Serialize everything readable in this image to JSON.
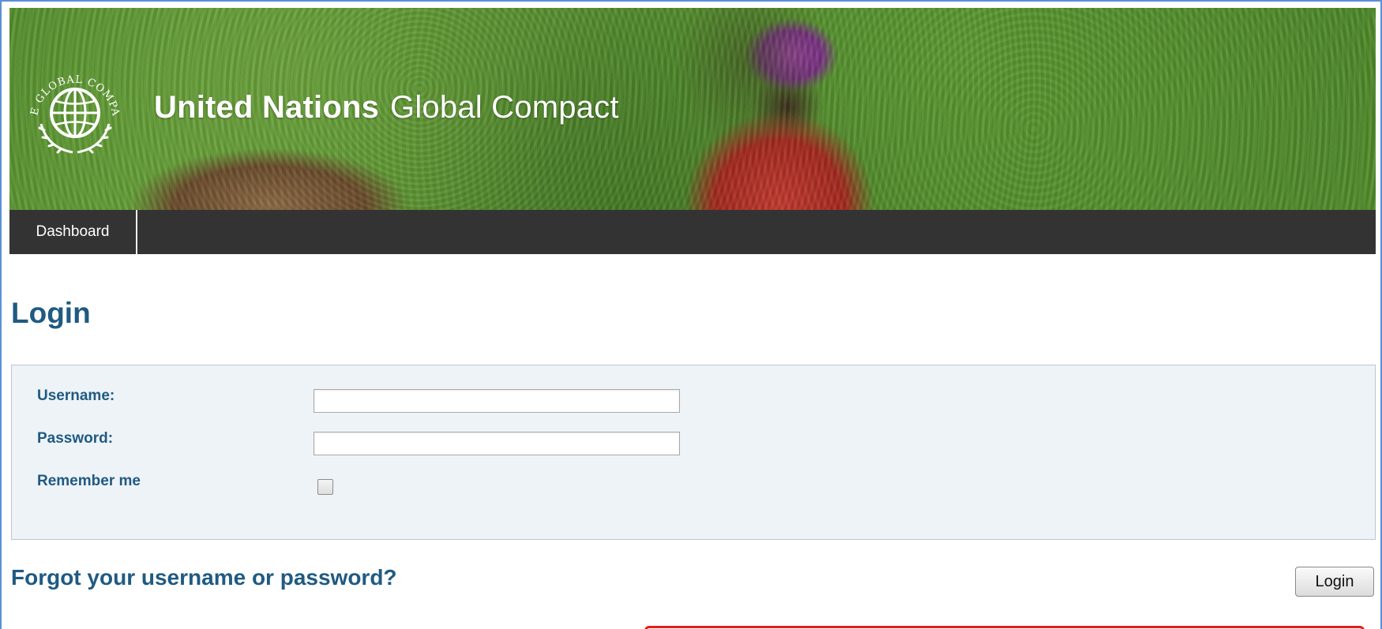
{
  "header": {
    "brand_bold": "United Nations",
    "brand_light": "Global Compact",
    "logo_text": "THE GLOBAL COMPACT"
  },
  "nav": {
    "tabs": [
      {
        "label": "Dashboard"
      }
    ]
  },
  "page": {
    "title": "Login"
  },
  "form": {
    "username": {
      "label": "Username:",
      "value": ""
    },
    "password": {
      "label": "Password:",
      "value": ""
    },
    "remember": {
      "label": "Remember me",
      "checked": false
    }
  },
  "links": {
    "forgot": "Forgot your username or password?"
  },
  "buttons": {
    "login": "Login"
  },
  "colors": {
    "heading": "#1f5a82",
    "nav_bg": "#333333",
    "panel_bg": "#eef3f8",
    "notice_border": "#e31d1d"
  }
}
